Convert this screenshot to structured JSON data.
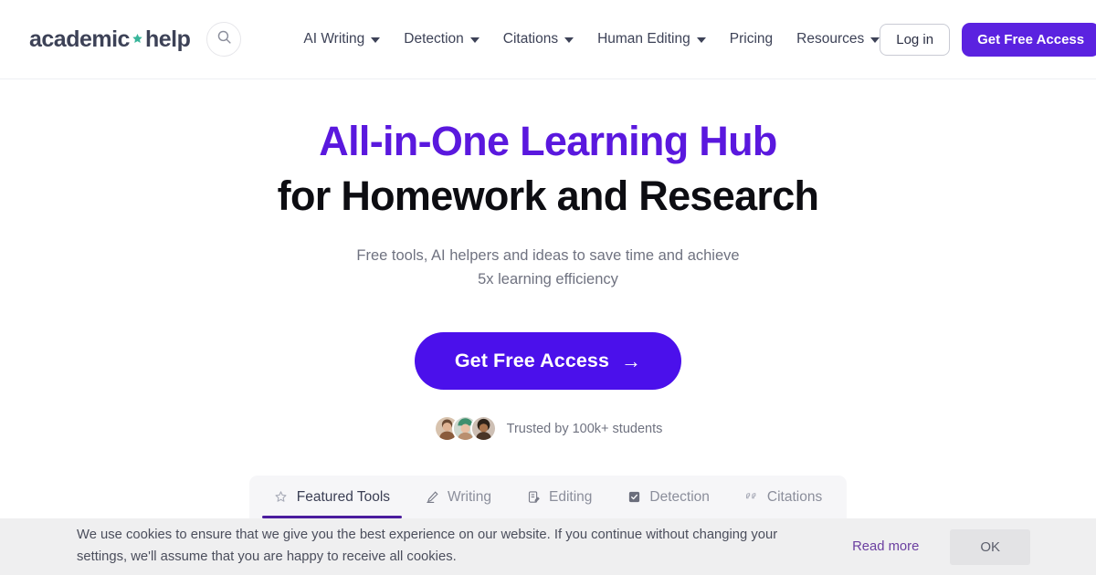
{
  "header": {
    "logo": {
      "part1": "academic",
      "part2": "help",
      "star_icon": "star-icon"
    },
    "search_icon": "search-icon",
    "nav": [
      {
        "label": "AI Writing",
        "has_dropdown": true
      },
      {
        "label": "Detection",
        "has_dropdown": true
      },
      {
        "label": "Citations",
        "has_dropdown": true
      },
      {
        "label": "Human Editing",
        "has_dropdown": true
      },
      {
        "label": "Pricing",
        "has_dropdown": false
      },
      {
        "label": "Resources",
        "has_dropdown": true
      }
    ],
    "login_label": "Log in",
    "cta_label": "Get Free Access"
  },
  "hero": {
    "headline_line1": "All-in-One Learning Hub",
    "headline_line2": "for Homework and Research",
    "subtitle_line1": "Free tools, AI helpers and ideas to save time and achieve",
    "subtitle_line2": "5x learning efficiency",
    "cta_label": "Get Free Access",
    "cta_arrow": "→",
    "trust_text": "Trusted by 100k+ students",
    "avatar_count": 3
  },
  "tabs": [
    {
      "label": "Featured Tools",
      "icon": "star-outline-icon",
      "active": true
    },
    {
      "label": "Writing",
      "icon": "pencil-icon",
      "active": false
    },
    {
      "label": "Editing",
      "icon": "document-edit-icon",
      "active": false
    },
    {
      "label": "Detection",
      "icon": "checkbox-icon",
      "active": false
    },
    {
      "label": "Citations",
      "icon": "quotation-marks-icon",
      "active": false
    }
  ],
  "cookie": {
    "text": "We use cookies to ensure that we give you the best experience on our website. If you continue without changing your settings, we'll assume that you are happy to receive all cookies.",
    "read_more_label": "Read more",
    "ok_label": "OK"
  },
  "colors": {
    "brand_purple": "#5b22e0",
    "headline_purple": "#5a18de",
    "cta_blue_violet": "#4b10eb",
    "logo_navy": "#3d4257",
    "star_green": "#38b59a",
    "tab_underline": "#4b1c9e",
    "cookie_bg": "#efeff0",
    "cookie_link": "#6b3fa0"
  }
}
